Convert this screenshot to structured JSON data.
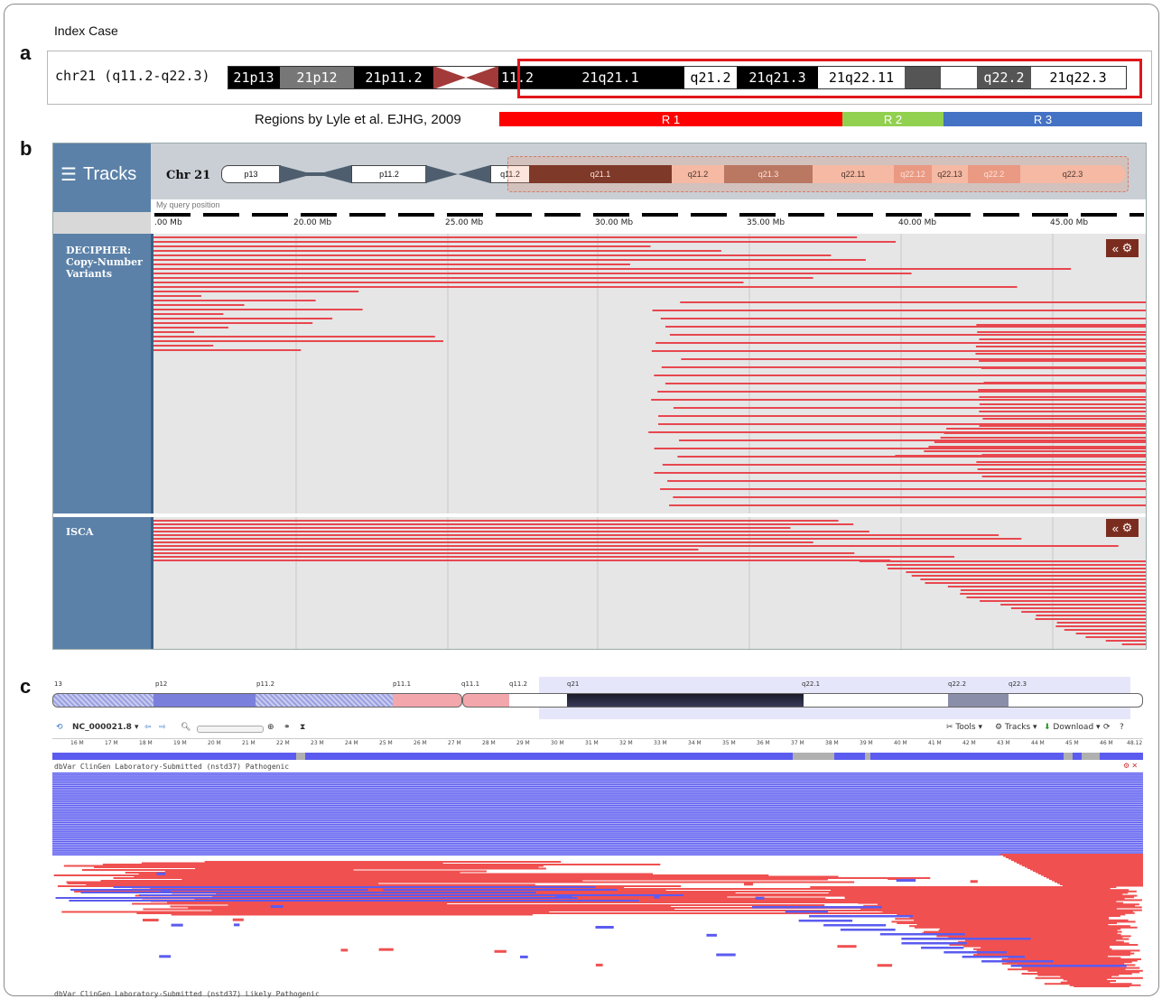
{
  "panels": {
    "a": "a",
    "b": "b",
    "c": "c"
  },
  "panel_a": {
    "index_case": "Index Case",
    "chrom_label": "chr21 (q11.2-q22.3)",
    "bands": [
      "21p13",
      "21p12",
      "21p11.2",
      "11.2",
      "21q21.1",
      "q21.2",
      "21q21.3",
      "21q22.11",
      "q22.2",
      "21q22.3"
    ],
    "regions_caption": "Regions by Lyle et al. EJHG, 2009",
    "regions": [
      {
        "label": "R 1",
        "color": "#ff0000"
      },
      {
        "label": "R 2",
        "color": "#92d050"
      },
      {
        "label": "R 3",
        "color": "#4472c4"
      }
    ]
  },
  "panel_b": {
    "menu": "Tracks",
    "chrom": "Chr 21",
    "bands": [
      "p13",
      "p11.2",
      "q11.2",
      "q21.1",
      "q21.2",
      "q21.3",
      "q22.11",
      "q22.12",
      "q22.13",
      "q22.2",
      "q22.3"
    ],
    "query_label": "My query position",
    "ruler": [
      ".00 Mb",
      "20.00 Mb",
      "25.00 Mb",
      "30.00 Mb",
      "35.00 Mb",
      "40.00 Mb",
      "45.00 Mb"
    ],
    "track1": "DECIPHER: Copy-Number Variants",
    "track2": "ISCA",
    "collapse_icon": "«",
    "settings_icon": "gear-icon",
    "variant_color": "#e8474f"
  },
  "panel_c": {
    "bands": [
      "13",
      "p12",
      "p11.2",
      "p11.1",
      "q11.1",
      "q11.2",
      "q21",
      "q22.1",
      "q22.2",
      "q22.3"
    ],
    "accession": "NC_000021.8",
    "tools": [
      "Tools",
      "Tracks",
      "Download"
    ],
    "ruler": [
      "16 M",
      "17 M",
      "18 M",
      "19 M",
      "20 M",
      "21 M",
      "22 M",
      "23 M",
      "24 M",
      "25 M",
      "26 M",
      "27 M",
      "28 M",
      "29 M",
      "30 M",
      "31 M",
      "32 M",
      "33 M",
      "34 M",
      "35 M",
      "36 M",
      "37 M",
      "38 M",
      "39 M",
      "40 M",
      "41 M",
      "42 M",
      "43 M",
      "44 M",
      "45 M",
      "46 M",
      "48.12"
    ],
    "track1": "dbVar ClinGen Laboratory-Submitted (nstd37) Pathogenic",
    "track2": "dbVar ClinGen Laboratory-Submitted (nstd37) Likely Pathogenic",
    "blue": "#5b5bf0",
    "red": "#f05050"
  }
}
